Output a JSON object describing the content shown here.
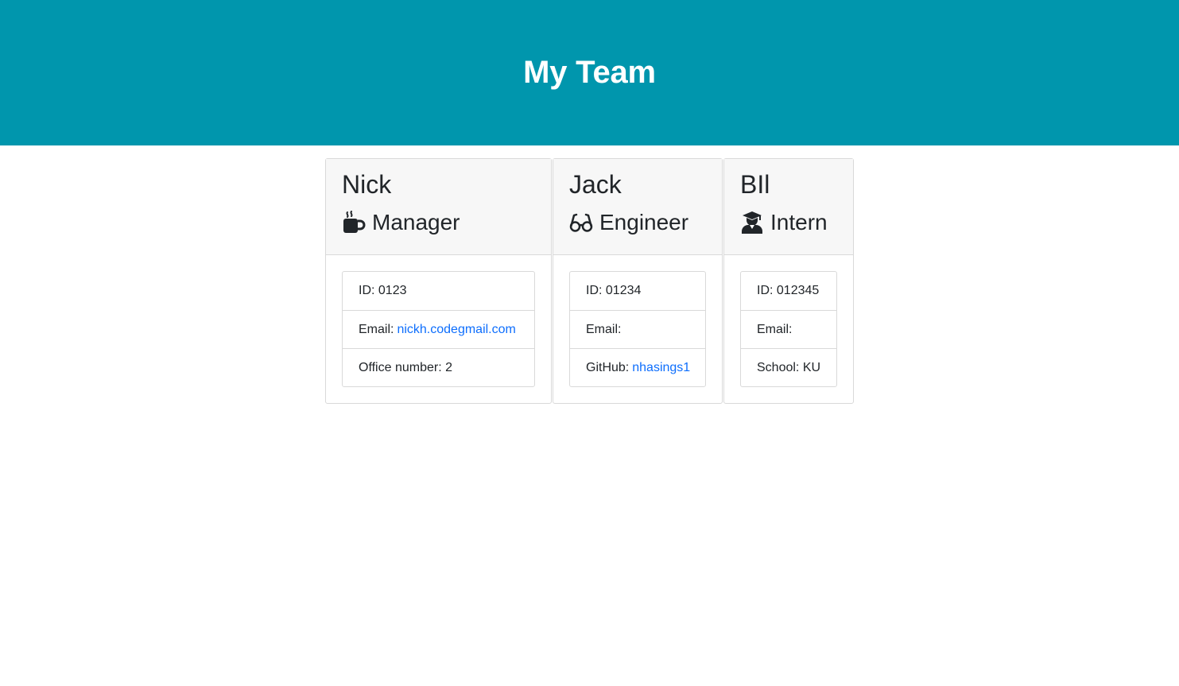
{
  "header": {
    "title": "My Team"
  },
  "team": [
    {
      "name": "Nick",
      "role": "Manager",
      "role_icon": "coffee-mug-icon",
      "id_label": "ID: 0123",
      "email_label": "Email:",
      "email": "nickh.codegmail.com",
      "extra_label": "Office number: 2"
    },
    {
      "name": "Jack",
      "role": "Engineer",
      "role_icon": "glasses-icon",
      "id_label": "ID: 01234",
      "email_label": "Email:",
      "email": "",
      "extra_label": "GitHub:",
      "github": "nhasings1"
    },
    {
      "name": "BIl",
      "role": "Intern",
      "role_icon": "graduate-icon",
      "id_label": "ID: 012345",
      "email_label": "Email:",
      "email": "",
      "extra_label": "School: KU"
    }
  ],
  "colors": {
    "header_bg": "#0096ad",
    "link": "#0d6efd"
  }
}
